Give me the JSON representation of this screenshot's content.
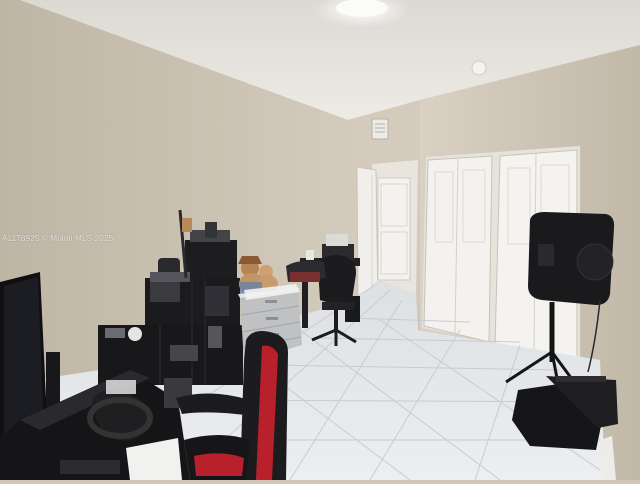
{
  "photo": {
    "watermark": "A1178925 © Miami MLS 2025",
    "colors": {
      "wall": "#cfc6b6",
      "ceiling": "#e8e5df",
      "floor_tile": "#e6e8ea",
      "closet_door": "#f2f1ee",
      "furniture": "#1b1b1d",
      "chair_accent": "#b8202c"
    }
  }
}
